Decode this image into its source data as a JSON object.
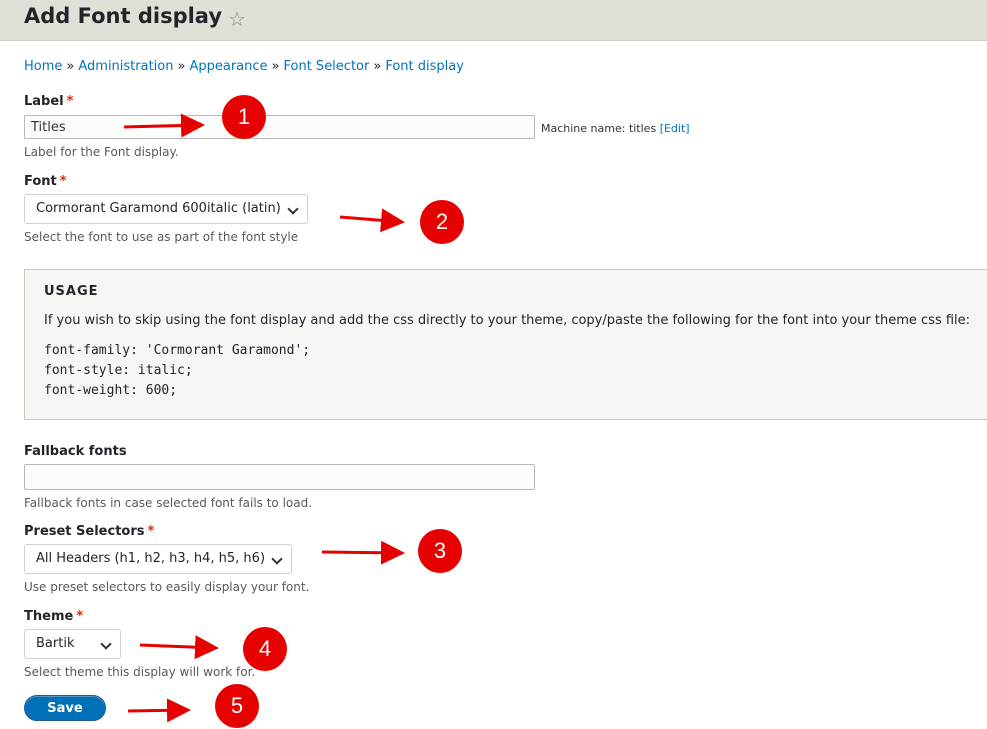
{
  "header": {
    "title": "Add Font display",
    "star_glyph": "☆"
  },
  "breadcrumb": [
    {
      "label": "Home"
    },
    {
      "label": "Administration"
    },
    {
      "label": "Appearance"
    },
    {
      "label": "Font Selector"
    },
    {
      "label": "Font display"
    }
  ],
  "breadcrumb_separator": "»",
  "required_marker": "*",
  "form": {
    "label": {
      "title": "Label",
      "value": "Titles",
      "machine_name_prefix": "Machine name: titles",
      "machine_name_edit": "[Edit]",
      "description": "Label for the Font display."
    },
    "font": {
      "title": "Font",
      "selected": "Cormorant Garamond 600italic (latin)",
      "description": "Select the font to use as part of the font style"
    },
    "usage": {
      "title": "USAGE",
      "text": "If you wish to skip using the font display and add the css directly to your theme, copy/paste the following for the font into your theme css file:",
      "code": [
        "font-family: 'Cormorant Garamond';",
        "font-style: italic;",
        "font-weight: 600;"
      ]
    },
    "fallback": {
      "title": "Fallback fonts",
      "value": "",
      "description": "Fallback fonts in case selected font fails to load."
    },
    "preset": {
      "title": "Preset Selectors",
      "selected": "All Headers (h1, h2, h3, h4, h5, h6)",
      "description": "Use preset selectors to easily display your font."
    },
    "theme": {
      "title": "Theme",
      "selected": "Bartik",
      "description": "Select theme this display will work for."
    },
    "save_label": "Save"
  },
  "annotations": {
    "badges": [
      "1",
      "2",
      "3",
      "4",
      "5"
    ],
    "color": "#e60000"
  },
  "colors": {
    "link": "#0074bd",
    "required": "#e62600",
    "primary_button": "#0071b8",
    "header_bg": "#e0dfd8"
  }
}
